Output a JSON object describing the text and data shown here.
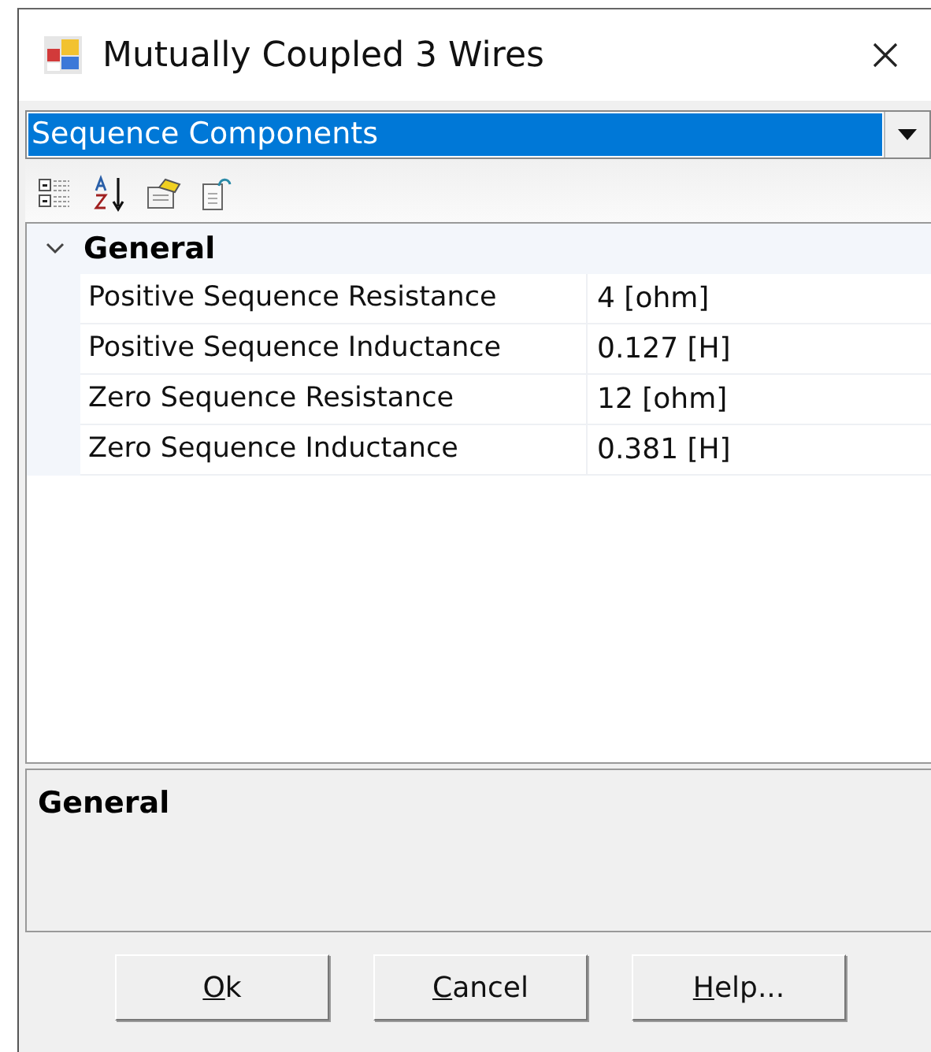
{
  "window": {
    "title": "Mutually Coupled 3 Wires"
  },
  "object_selector": {
    "value": "Sequence Components"
  },
  "categories": [
    {
      "name": "General",
      "expanded": true,
      "properties": [
        {
          "name": "Positive Sequence Resistance",
          "value": "4 [ohm]"
        },
        {
          "name": "Positive Sequence Inductance",
          "value": "0.127 [H]"
        },
        {
          "name": "Zero Sequence Resistance",
          "value": "12 [ohm]"
        },
        {
          "name": "Zero Sequence Inductance",
          "value": "0.381 [H]"
        }
      ]
    }
  ],
  "description": {
    "title": "General"
  },
  "buttons": [
    "Ok",
    "Cancel",
    "Help..."
  ]
}
